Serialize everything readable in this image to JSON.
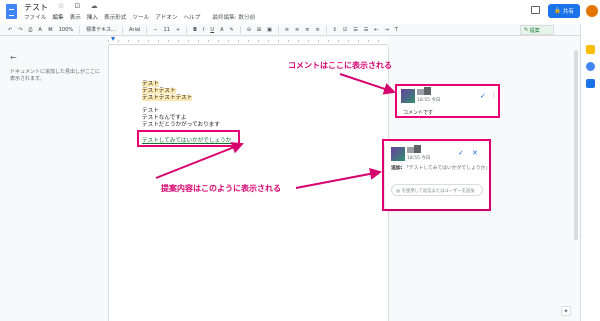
{
  "header": {
    "title": "テスト",
    "title_icons": "☆ ⊡ ☁",
    "menu": [
      "ファイル",
      "編集",
      "表示",
      "挿入",
      "表示形式",
      "ツール",
      "アドオン",
      "ヘルプ"
    ],
    "saved_status": "最終編集: 数分前",
    "share_label": "共有"
  },
  "toolbar": {
    "zoom": "100%",
    "style": "標準テキス…",
    "font": "Arial",
    "font_size": "11",
    "mode": "提案"
  },
  "outline": {
    "back_icon": "←",
    "note": "ドキュメントに追加した見出しがここに表示されます。"
  },
  "document": {
    "lines": [
      "テスト",
      "テストテスト",
      "テストテストテスト",
      "テスト",
      "テストなんですよ",
      "テストだとうかがっております"
    ],
    "suggestion": "テストしてみてはいかがでしょうか"
  },
  "comment_card": {
    "time": "18:55 今日",
    "body": "コメントです"
  },
  "suggestion_card": {
    "time": "18:55 今日",
    "label": "追加:",
    "text": "「テストしてみてはいかがでしょうか」",
    "reply_placeholder": "@ を使用して返信またはユーザーを追加"
  },
  "annotations": {
    "comment": "コメントはここに表示される",
    "suggestion": "提案内容はこのように表示される"
  },
  "colors": {
    "accent": "#1a73e8",
    "annotation": "#e60073",
    "highlight": "#fce8b2",
    "suggestion_text": "#137333"
  }
}
